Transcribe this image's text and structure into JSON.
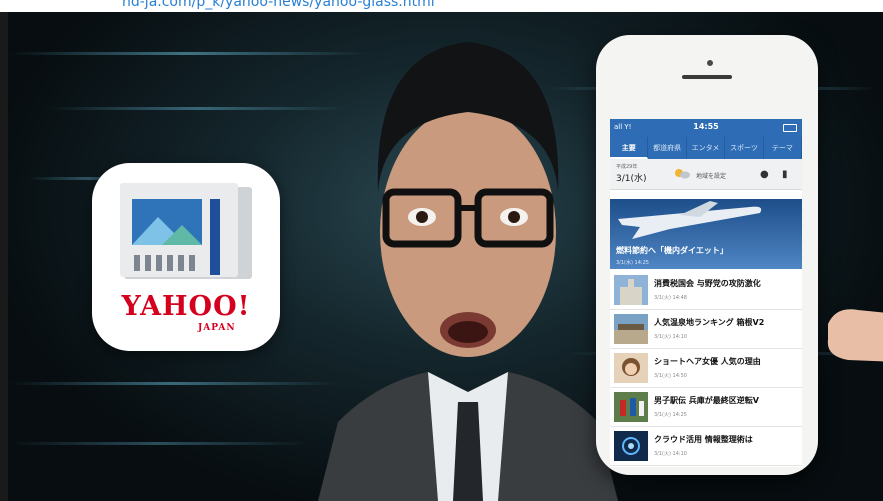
{
  "top_link": "nd-ja.com/p_k/yahoo-news/yahoo-glass.html",
  "app_icon": {
    "brand": "YAHOO!",
    "sub_brand": "JAPAN",
    "icon_name": "newspaper-icon"
  },
  "phone": {
    "status": {
      "carrier": "all Y! ",
      "time": "14:55"
    },
    "tabs": [
      {
        "label": "主要"
      },
      {
        "label": "都道府県"
      },
      {
        "label": "エンタメ"
      },
      {
        "label": "スポーツ"
      },
      {
        "label": "テーマ"
      }
    ],
    "date_bar": {
      "era": "平成29年",
      "date": "3/1(水)",
      "region_label": "地域を設定"
    },
    "hero": {
      "caption": "燃料節約へ「機内ダイエット」",
      "timestamp": "3/1(水) 14:25"
    },
    "news": [
      {
        "title": "消費税国会 与野党の攻防激化",
        "date": "3/1(火) 14:48"
      },
      {
        "title": "人気温泉地ランキング 箱根V2",
        "date": "3/1(火) 14:10"
      },
      {
        "title": "ショートヘア女優 人気の理由",
        "date": "3/1(火) 14:50"
      },
      {
        "title": "男子駅伝 兵庫が最終区逆転V",
        "date": "3/1(火) 14:25"
      },
      {
        "title": "クラウド活用 情報整理術は",
        "date": "3/1(火) 14:10"
      }
    ]
  },
  "colors": {
    "brand_red": "#d4001e",
    "tab_blue": "#2e6db5",
    "accent_cyan": "#6ec8e6"
  }
}
